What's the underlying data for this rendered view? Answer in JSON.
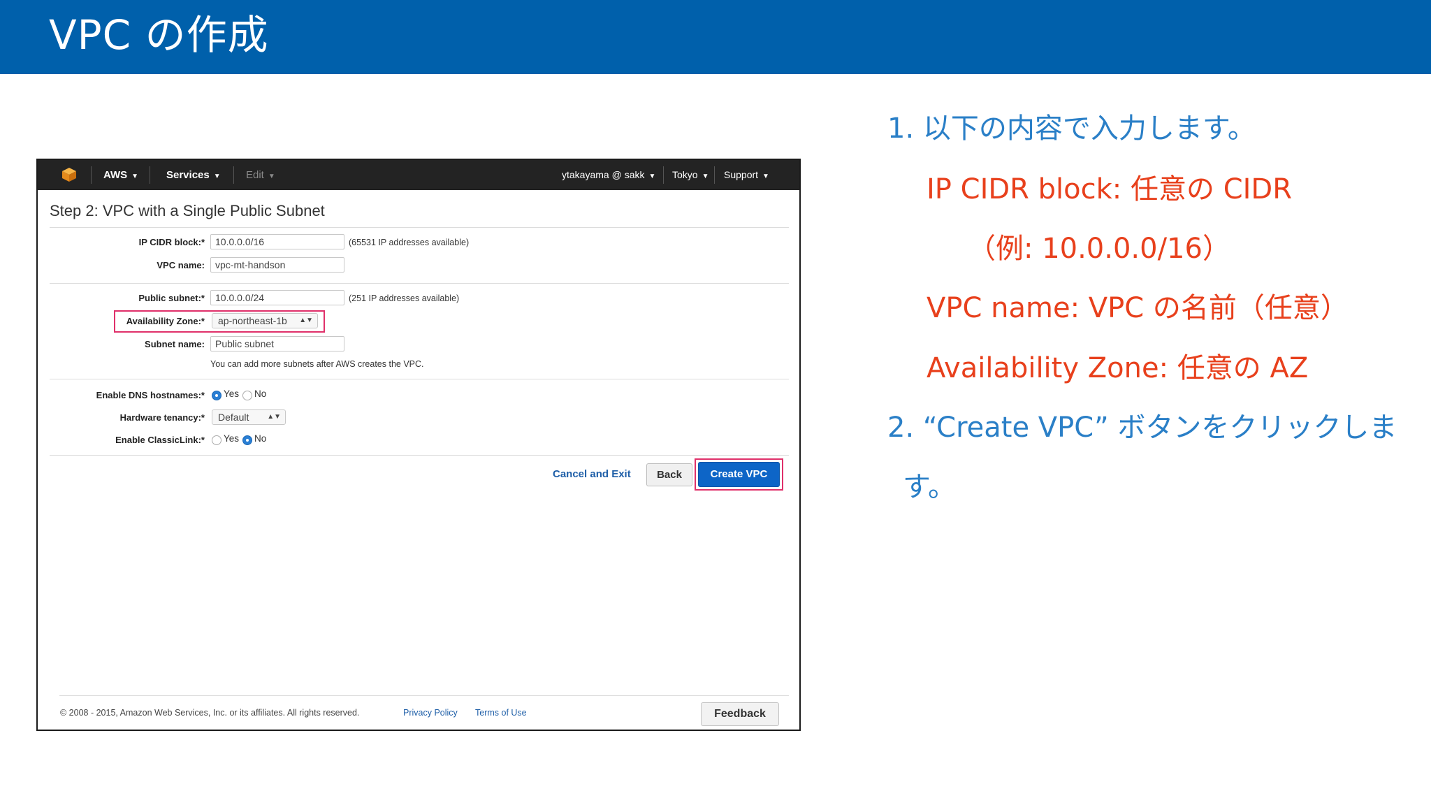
{
  "slide": {
    "title": "VPC の作成",
    "header_color": "#0060ab"
  },
  "aws": {
    "nav": {
      "logo_icon": "aws-cube-icon",
      "aws": "AWS",
      "services": "Services",
      "edit": "Edit",
      "account": "ytakayama @ sakk",
      "region": "Tokyo",
      "support": "Support"
    },
    "step_title": "Step 2: VPC with a Single Public Subnet",
    "fields": {
      "ip_cidr_label": "IP CIDR block:*",
      "ip_cidr_value": "10.0.0.0/16",
      "ip_cidr_note": "(65531 IP addresses available)",
      "vpc_name_label": "VPC name:",
      "vpc_name_value": "vpc-mt-handson",
      "public_subnet_label": "Public subnet:*",
      "public_subnet_value": "10.0.0.0/24",
      "public_subnet_note": "(251 IP addresses available)",
      "az_label": "Availability Zone:*",
      "az_value": "ap-northeast-1b",
      "subnet_name_label": "Subnet name:",
      "subnet_name_value": "Public subnet",
      "subnets_hint": "You can add more subnets after AWS creates the VPC.",
      "dns_label": "Enable DNS hostnames:*",
      "dns_selected": "Yes",
      "tenancy_label": "Hardware tenancy:*",
      "tenancy_value": "Default",
      "classiclink_label": "Enable ClassicLink:*",
      "classiclink_selected": "No",
      "yes": "Yes",
      "no": "No"
    },
    "actions": {
      "cancel": "Cancel and Exit",
      "back": "Back",
      "create": "Create VPC"
    },
    "footer": {
      "copyright": "© 2008 - 2015, Amazon Web Services, Inc. or its affiliates. All rights reserved.",
      "privacy": "Privacy Policy",
      "terms": "Terms of Use",
      "feedback": "Feedback"
    },
    "highlight_color": "#e0306a"
  },
  "instructions": {
    "step1": "1. 以下の内容で入力します。",
    "item1": "IP CIDR block: 任意の CIDR",
    "item1_example": "（例: 10.0.0.0/16）",
    "item2": "VPC name: VPC の名前（任意）",
    "item3": "Availability Zone: 任意の AZ",
    "step2_line1": "2. “Create VPC” ボタンをクリックしま",
    "step2_line2": "す。",
    "blue": "#2a7fc7",
    "red": "#e8401c"
  }
}
